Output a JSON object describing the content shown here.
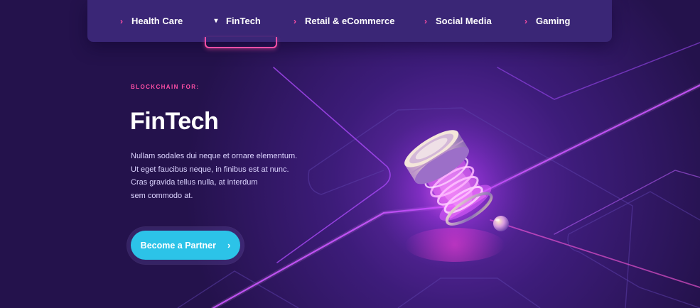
{
  "tabs": [
    {
      "label": "Health Care",
      "icon": "chevron-right-icon",
      "active": false
    },
    {
      "label": "FinTech",
      "icon": "chevron-down-icon",
      "active": true
    },
    {
      "label": "Retail & eCommerce",
      "icon": "chevron-right-icon",
      "active": false
    },
    {
      "label": "Social Media",
      "icon": "chevron-right-icon",
      "active": false
    },
    {
      "label": "Gaming",
      "icon": "chevron-right-icon",
      "active": false
    }
  ],
  "hero": {
    "eyebrow": "BLOCKCHAIN FOR:",
    "title": "FinTech",
    "body_lines": [
      "Nullam sodales dui neque et ornare elementum.",
      "Ut eget faucibus neque, in finibus est at nunc.",
      "Cras gravida tellus nulla, at interdum",
      "sem commodo at."
    ],
    "cta_label": "Become a Partner",
    "cta_icon": "chevron-right-icon"
  },
  "colors": {
    "background": "#26134f",
    "tabbar": "#3a2676",
    "accent_pink": "#ff4fa6",
    "cta": "#2cc3e8",
    "glow_magenta": "#e24cff"
  }
}
